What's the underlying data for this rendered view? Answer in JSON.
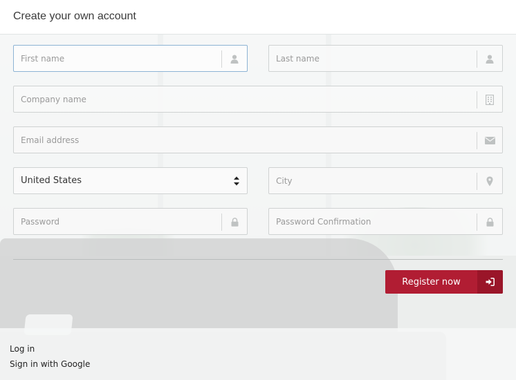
{
  "header": {
    "title": "Create your own account"
  },
  "form": {
    "first_name": {
      "placeholder": "First name",
      "icon": "user-icon"
    },
    "last_name": {
      "placeholder": "Last name",
      "icon": "user-icon"
    },
    "company": {
      "placeholder": "Company name",
      "icon": "building-icon"
    },
    "email": {
      "placeholder": "Email address",
      "icon": "envelope-icon"
    },
    "country": {
      "value": "United States",
      "icon": "sort-caret-icon"
    },
    "city": {
      "placeholder": "City",
      "icon": "map-marker-icon"
    },
    "password": {
      "placeholder": "Password",
      "icon": "lock-icon"
    },
    "password_confirmation": {
      "placeholder": "Password Confirmation",
      "icon": "lock-icon"
    },
    "register_label": "Register now",
    "register_icon": "sign-in-icon"
  },
  "links": {
    "login": "Log in",
    "google": "Sign in with Google"
  },
  "colors": {
    "accent": "#b11d33",
    "accent_dark": "#9a1529",
    "focus_border": "#8db3d4"
  }
}
